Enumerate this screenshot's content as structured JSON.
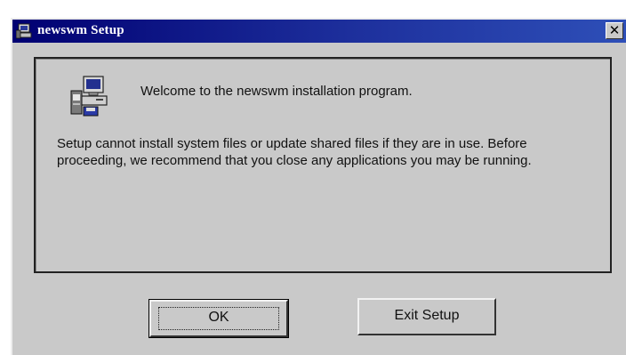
{
  "window": {
    "title": "newswm Setup",
    "close_glyph": "✕",
    "title_icon": "setup-computer-icon"
  },
  "content": {
    "icon": "computer-setup-icon",
    "welcome": "Welcome to the newswm installation program.",
    "message": "Setup cannot install system files or update shared files if they are in use. Before proceeding, we recommend that you close any applications you may be running."
  },
  "buttons": {
    "ok_label": "OK",
    "exit_label": "Exit Setup"
  },
  "colors": {
    "titlebar_start": "#000072",
    "titlebar_end": "#2e4fb8",
    "face": "#c9c9c9"
  }
}
